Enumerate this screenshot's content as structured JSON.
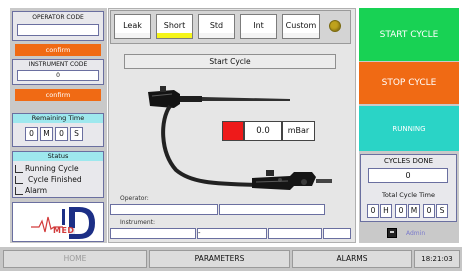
{
  "operator": {
    "title": "OPERATOR CODE",
    "value": "",
    "confirm_label": "confirm"
  },
  "instrument": {
    "title": "INSTRUMENT CODE",
    "value": "0",
    "confirm_label": "confirm"
  },
  "remaining": {
    "title": "Remaining Time",
    "minutes": "0",
    "m_label": "M",
    "seconds": "0",
    "s_label": "S"
  },
  "status": {
    "title": "Status",
    "items": [
      "Running Cycle",
      "Cycle Finished",
      "Alarm"
    ]
  },
  "logo": {
    "text": "MED",
    "icon": "heartbeat-logo"
  },
  "tabs": [
    {
      "label": "Leak",
      "indicator": "#f4f4f4"
    },
    {
      "label": "Short",
      "indicator": "#f5f51a"
    },
    {
      "label": "Std",
      "indicator": "#f4f4f4"
    },
    {
      "label": "Int",
      "indicator": "#f4f4f4"
    },
    {
      "label": "Custom",
      "indicator": "#f4f4f4"
    }
  ],
  "status_led_color": "#bfa21c",
  "cycle_label": "Start Cycle",
  "pressure": {
    "value": "0.0",
    "unit": "mBar",
    "indicator_color": "#ee1a1a"
  },
  "fields": {
    "operator_label": "Operator:",
    "instrument_label": "Instrument:",
    "instrument_sep": "-"
  },
  "controls": {
    "start_label": "START CYCLE",
    "start_color": "#18d254",
    "stop_label": "STOP CYCLE",
    "stop_color": "#f06a14",
    "running_label": "RUNNING",
    "running_color": "#2ad4c6"
  },
  "cycles": {
    "title": "CYCLES DONE",
    "value": "0",
    "total_title": "Total Cycle Time",
    "hours": "0",
    "h_label": "H",
    "minutes": "0",
    "m_label": "M",
    "seconds": "0",
    "s_label": "S"
  },
  "admin": {
    "label": "Admin",
    "icon": "keypad-icon"
  },
  "nav": {
    "home": "HOME",
    "parameters": "PARAMETERS",
    "alarms": "ALARMS",
    "clock": "18:21:03"
  }
}
